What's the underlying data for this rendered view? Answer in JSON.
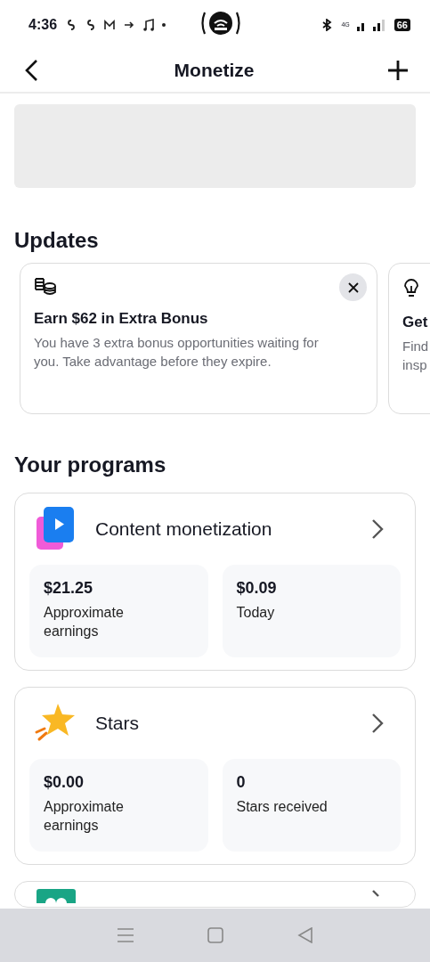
{
  "status_bar": {
    "time": "4:36",
    "network": "4G",
    "battery": "66"
  },
  "header": {
    "title": "Monetize"
  },
  "updates": {
    "heading": "Updates",
    "cards": [
      {
        "kind": "coins",
        "title": "Earn $62 in Extra Bonus",
        "description": "You have 3 extra bonus opportunities waiting for you. Take advantage before they expire.",
        "dismissible": true
      },
      {
        "kind": "bulb",
        "title": "Get",
        "description": "Find insp",
        "dismissible": false
      }
    ]
  },
  "programs": {
    "heading": "Your programs",
    "items": [
      {
        "kind": "content",
        "title": "Content monetization",
        "stats": [
          {
            "value": "$21.25",
            "label": "Approximate earnings"
          },
          {
            "value": "$0.09",
            "label": "Today"
          }
        ]
      },
      {
        "kind": "stars",
        "title": "Stars",
        "stats": [
          {
            "value": "$0.00",
            "label": "Approximate earnings"
          },
          {
            "value": "0",
            "label": "Stars received"
          }
        ]
      },
      {
        "kind": "other"
      }
    ]
  }
}
